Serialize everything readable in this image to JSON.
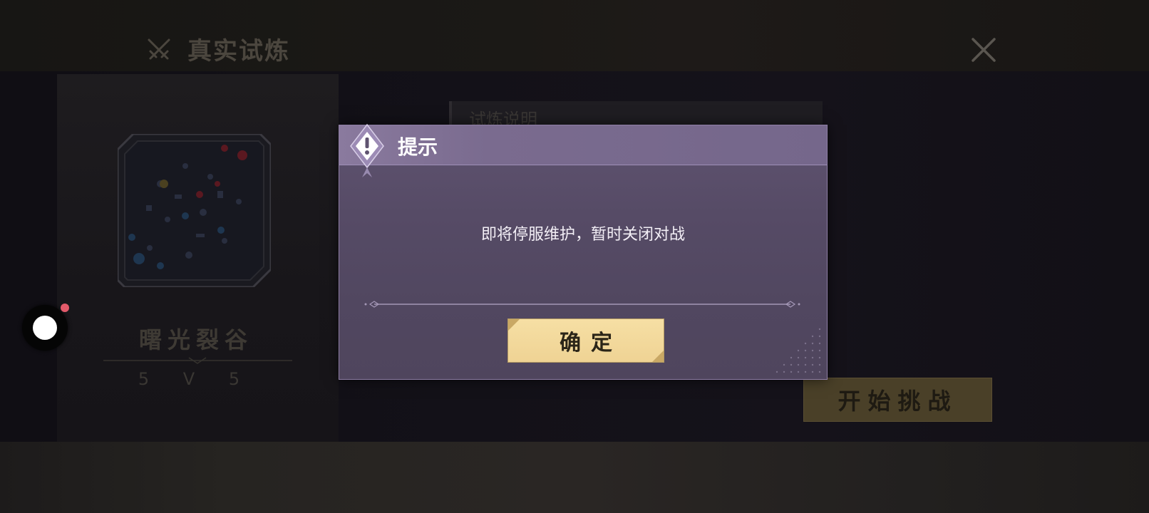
{
  "header": {
    "title": "真实试炼",
    "title_icon": "crossed-swords-icon",
    "close_icon": "close-icon"
  },
  "map": {
    "name": "曙光裂谷",
    "mode": "5 V 5"
  },
  "rules": {
    "title": "试炼说明"
  },
  "start_button": {
    "label": "开始挑战"
  },
  "dialog": {
    "title": "提示",
    "icon": "alert-icon",
    "message": "即将停服维护，暂时关闭对战",
    "confirm_label": "确定"
  },
  "overlay": {
    "float_button_icon": "floating-record-button",
    "notification": "red-dot"
  },
  "colors": {
    "dialog_header": "#7a6b8f",
    "dialog_body": "#564b66",
    "confirm_button": "#f2d698",
    "start_button": "#4a4028",
    "notify_dot": "#e35a6a"
  }
}
